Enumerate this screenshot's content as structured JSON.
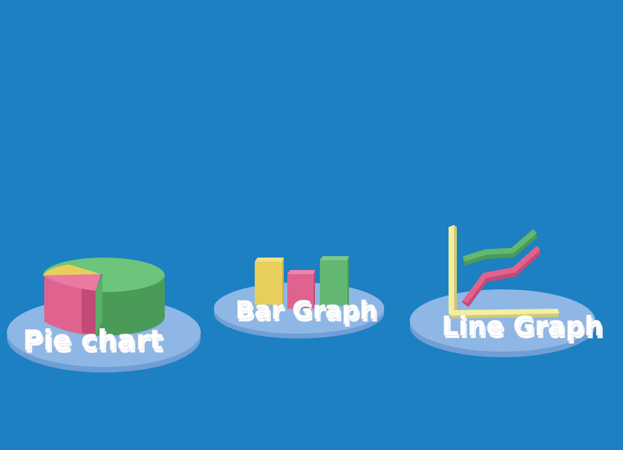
{
  "labels": {
    "pie": "Pie chart",
    "bar": "Bar Graph",
    "line": "Line Graph"
  },
  "colors": {
    "background": "#1c80c2",
    "platform_top": "#8eb7e6",
    "platform_side": "#6f9fd6",
    "yellow": "#e8cf5d",
    "yellow_dark": "#c9ae3f",
    "pink": "#e0638f",
    "pink_dark": "#c24a77",
    "green": "#62b870",
    "green_dark": "#4a9a58",
    "axis": "#f3ef9e",
    "axis_dark": "#cfca78",
    "label_fill": "#ffffff",
    "label_shadow": "#aab3c2"
  },
  "icons": [
    "pie-chart-icon",
    "bar-graph-icon",
    "line-graph-icon"
  ]
}
